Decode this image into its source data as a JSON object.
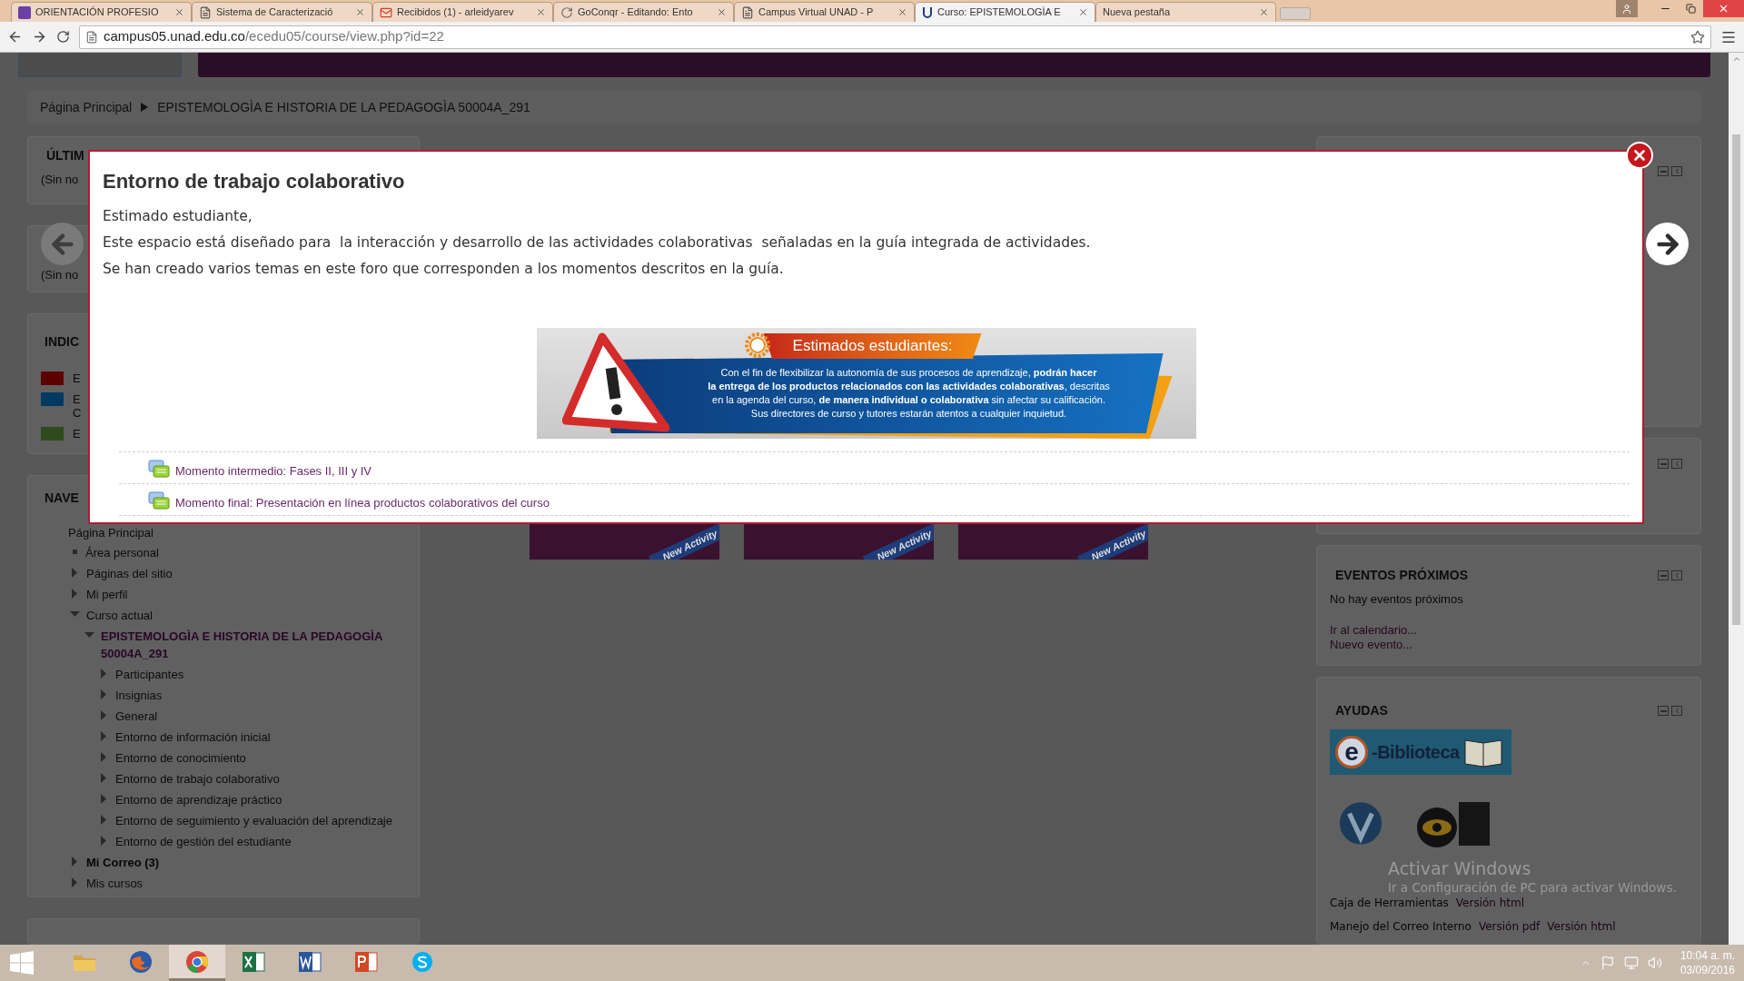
{
  "browser": {
    "tabs": [
      {
        "title": "ORIENTACIÓN PROFESIO",
        "kind": "form",
        "selected": false
      },
      {
        "title": "Sistema de Caracterizació",
        "kind": "page",
        "selected": false
      },
      {
        "title": "Recibidos (1) - arleidyarev",
        "kind": "mail",
        "selected": false
      },
      {
        "title": "GoConqr - Editando: Ento",
        "kind": "swirl",
        "selected": false
      },
      {
        "title": "Campus Virtual UNAD - P",
        "kind": "page",
        "selected": false
      },
      {
        "title": "Curso: EPISTEMOLOGÌA E",
        "kind": "unad",
        "selected": true
      },
      {
        "title": "Nueva pestaña",
        "kind": "blank",
        "selected": false
      }
    ],
    "address": {
      "host": "campus05.unad.edu.co",
      "path": "/ecedu05/course/view.php?id=22"
    }
  },
  "breadcrumb": [
    "Página Principal",
    "EPISTEMOLOGÌA E HISTORIA DE LA PEDAGOGÌA 50004A_291"
  ],
  "recent_blocks": [
    {
      "title": "ÚLTIM",
      "text": "(Sin no"
    },
    {
      "text": "(Sin no"
    }
  ],
  "legend": {
    "title": "INDIC",
    "items": [
      {
        "color": "#5c0000",
        "lines": [
          "E"
        ]
      },
      {
        "color": "#003a63",
        "lines": [
          "E",
          "C"
        ]
      },
      {
        "color": "#2f4a1d",
        "lines": [
          "E"
        ]
      }
    ]
  },
  "navigation": {
    "title": "NAVE",
    "home": "Página Principal",
    "items": [
      {
        "label": "Área personal",
        "kind": "leaf"
      },
      {
        "label": "Páginas del sitio",
        "kind": "branch",
        "expanded": false
      },
      {
        "label": "Mi perfil",
        "kind": "branch",
        "expanded": false
      },
      {
        "label": "Curso actual",
        "kind": "branch",
        "expanded": true,
        "children": [
          {
            "label": "EPISTEMOLOGÌA E HISTORIA DE LA PEDAGOGÌA 50004A_291",
            "kind": "course",
            "expanded": true,
            "children": [
              {
                "label": "Participantes",
                "kind": "branch",
                "expanded": false
              },
              {
                "label": "Insignias",
                "kind": "branch",
                "expanded": false
              },
              {
                "label": "General",
                "kind": "branch",
                "expanded": false
              },
              {
                "label": "Entorno de información inicial",
                "kind": "branch",
                "expanded": false
              },
              {
                "label": "Entorno de conocimiento",
                "kind": "branch",
                "expanded": false
              },
              {
                "label": "Entorno de trabajo colaborativo",
                "kind": "branch",
                "expanded": false
              },
              {
                "label": "Entorno de aprendizaje práctico",
                "kind": "branch",
                "expanded": false
              },
              {
                "label": "Entorno de seguimiento y evaluación del aprendizaje",
                "kind": "branch",
                "expanded": false
              },
              {
                "label": "Entorno de gestión del estudiante",
                "kind": "branch",
                "expanded": false
              }
            ]
          }
        ]
      },
      {
        "label": "Mi Correo (3)",
        "kind": "mail",
        "expanded": false
      },
      {
        "label": "Mis cursos",
        "kind": "branch",
        "expanded": false
      }
    ]
  },
  "activity_tiles": [
    {
      "ribbon": "New Activity"
    },
    {
      "ribbon": "New Activity"
    },
    {
      "ribbon": "New Activity"
    }
  ],
  "modal": {
    "title": "Entorno de trabajo colaborativo",
    "paragraphs": [
      "Estimado estudiante,",
      "Este espacio está diseñado para  la interacción y desarrollo de las actividades colaborativas  señaladas en la guía integrada de actividades.",
      "Se han creado varios temas en este foro que corresponden a los momentos descritos en la guía."
    ],
    "banner": {
      "title": "Estimados estudiantes:",
      "lines": [
        "Con el fin de flexibilizar la autonomía de sus procesos de aprendizaje, **podrán hacer**",
        "**la entrega de los productos relacionados con las actividades colaborativas**, descritas",
        "en la agenda del curso, **de manera individual o colaborativa** sin afectar su calificación.",
        "Sus directores de curso y tutores estarán atentos a cualquier inquietud."
      ]
    },
    "topics": [
      "Momento intermedio: Fases II, III y IV",
      "Momento final: Presentación en línea productos colaborativos del curso"
    ]
  },
  "events": {
    "title": "EVENTOS PRÓXIMOS",
    "text": "No hay eventos próximos",
    "links": [
      "Ir al calendario...",
      "Nuevo evento..."
    ]
  },
  "helps": {
    "title": "AYUDAS",
    "library": {
      "letter": "e",
      "label": "-Biblioteca"
    },
    "rows": [
      {
        "label": "Caja de Herramientas",
        "links": [
          "Versión html"
        ]
      },
      {
        "label": "Manejo del Correo Interno",
        "links": [
          "Versión pdf",
          "Versión html"
        ]
      }
    ]
  },
  "activation": {
    "title": "Activar Windows",
    "text": "Ir a Configuración de PC para activar Windows."
  },
  "taskbar": {
    "apps": [
      {
        "kind": "explorer",
        "selected": false
      },
      {
        "kind": "firefox",
        "selected": false
      },
      {
        "kind": "chrome",
        "selected": true
      },
      {
        "kind": "excel",
        "selected": false
      },
      {
        "kind": "word",
        "selected": false
      },
      {
        "kind": "powerpoint",
        "selected": false
      },
      {
        "kind": "skype",
        "selected": false
      }
    ],
    "time": "10:04 a. m.",
    "date": "03/09/2016"
  }
}
